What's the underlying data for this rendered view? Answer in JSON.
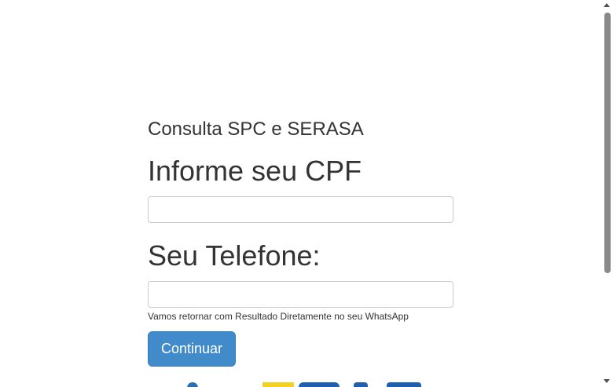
{
  "form": {
    "subtitle": "Consulta SPC e SERASA",
    "cpf_label": "Informe seu CPF",
    "cpf_value": "",
    "phone_label": "Seu Telefone:",
    "phone_value": "",
    "help_text": "Vamos retornar com Resultado Diretamente no seu WhatsApp",
    "submit_label": "Continuar"
  },
  "icons": {
    "logo": "spc-logo-partial",
    "scroll_up": "chevron-up-icon",
    "scroll_down": "chevron-down-icon"
  },
  "colors": {
    "button_bg": "#428bca",
    "button_text": "#ffffff",
    "text": "#333333",
    "input_border": "#cccccc",
    "logo_blue": "#1f5fae",
    "logo_yellow": "#f2d024"
  }
}
